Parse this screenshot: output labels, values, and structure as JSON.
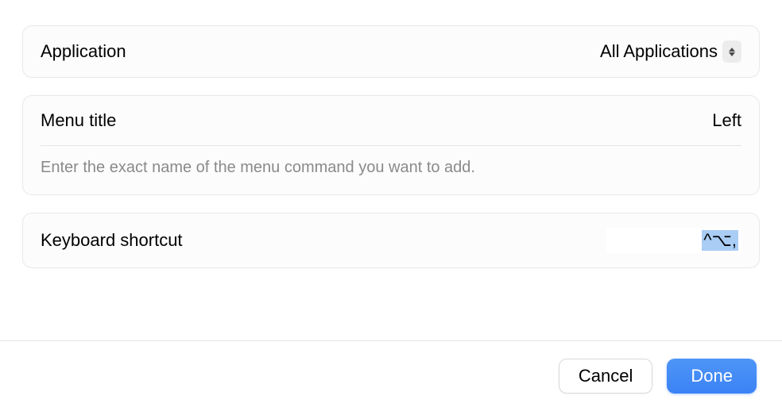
{
  "application": {
    "label": "Application",
    "value": "All Applications"
  },
  "menu": {
    "label": "Menu title",
    "value": "Left",
    "helper": "Enter the exact name of the menu command you want to add."
  },
  "shortcut": {
    "label": "Keyboard shortcut",
    "value": "^⌥,"
  },
  "buttons": {
    "cancel": "Cancel",
    "done": "Done"
  }
}
